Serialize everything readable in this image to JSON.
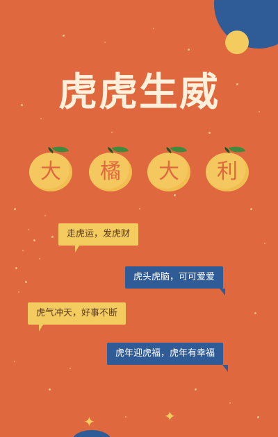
{
  "title": "虎虎生威",
  "oranges": [
    "大",
    "橘",
    "大",
    "利"
  ],
  "bubbles": [
    "走虎运，发虎财",
    "虎头虎脑，可可爱爱",
    "虎气冲天，好事不断",
    "虎年迎虎福，虎年有幸福"
  ],
  "colors": {
    "background": "#e0683e",
    "accent_yellow": "#f3cb5f",
    "accent_blue": "#2f5c97",
    "title_text": "#fff0dc",
    "leaf_green": "#3f8a3c"
  }
}
